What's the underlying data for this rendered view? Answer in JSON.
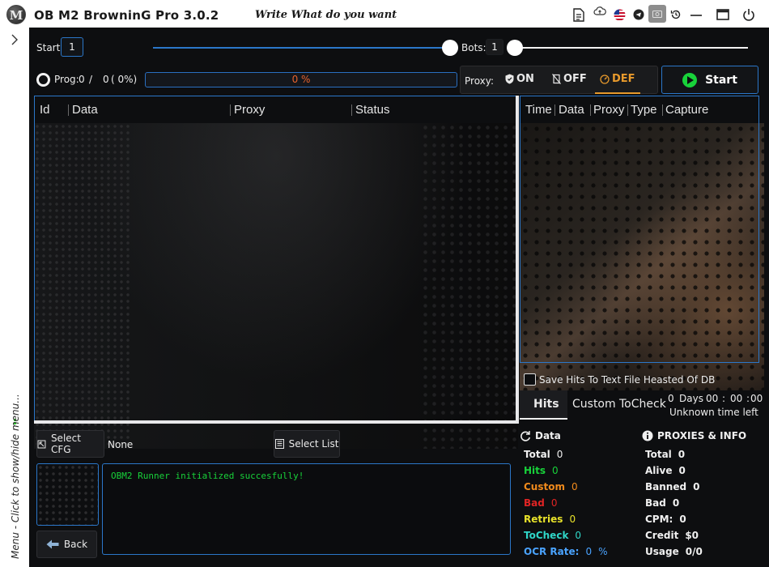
{
  "app": {
    "title": "OB M2 BrowninG Pro  3.0.2",
    "logo_letter": "M",
    "slogan": "Write What do you want"
  },
  "titlebar_icons": [
    "document-icon",
    "cloud-icon",
    "us-flag-icon",
    "telegram-icon",
    "screenshot-icon",
    "history-icon",
    "minimize-icon",
    "maximize-icon",
    "power-icon"
  ],
  "menu": {
    "toggle_label": "Menu - Click to show/hide menu..."
  },
  "controls": {
    "start_label": "Start",
    "start_value": "1",
    "bots_label": "Bots:",
    "bots_value": "1"
  },
  "progress": {
    "prog_label": "Prog:",
    "done": "0",
    "sep": "/",
    "total": "0",
    "percent_text": "( 0%)",
    "bar_text": "0 %",
    "bar_fraction": 0.0
  },
  "proxy": {
    "label": "Proxy:",
    "on": "ON",
    "off": "OFF",
    "def": "DEF",
    "selected": "DEF"
  },
  "start_button": "Start",
  "data_table": {
    "headers": [
      "Id",
      "Data",
      "Proxy",
      "Status"
    ]
  },
  "hits_table": {
    "headers": [
      "Time",
      "Data",
      "Proxy",
      "Type",
      "Capture"
    ]
  },
  "save_hits_label": "Save Hits To Text File Heasted Of DB",
  "tabs": [
    "Hits",
    "Custom",
    "ToCheck"
  ],
  "timer": {
    "days": "0",
    "days_label": "Days",
    "hours": "00",
    "minutes": "00",
    "seconds": "00",
    "colon": ":",
    "eta": "Unknown time left"
  },
  "config": {
    "select_cfg": "Select CFG",
    "cfg_value": "None",
    "select_list": "Select List",
    "back": "Back"
  },
  "log": {
    "line": "OBM2 Runner initialized succesfully!"
  },
  "data_stats": {
    "title": "Data",
    "items": [
      {
        "label": "Total",
        "value": "0",
        "color": "#f0f0f0"
      },
      {
        "label": "Hits",
        "value": "0",
        "color": "#18d23a"
      },
      {
        "label": "Custom",
        "value": "0",
        "color": "#f08a1c"
      },
      {
        "label": "Bad",
        "value": "0",
        "color": "#e02424"
      },
      {
        "label": "Retries",
        "value": "0",
        "color": "#e8e22a"
      },
      {
        "label": "ToCheck",
        "value": "0",
        "color": "#2fd6c8"
      },
      {
        "label": "OCR Rate:",
        "value": "0",
        "suffix": "%",
        "color": "#4aa3ff"
      }
    ]
  },
  "proxy_stats": {
    "title": "PROXIES & INFO",
    "items": [
      {
        "label": "Total",
        "value": "0"
      },
      {
        "label": "Alive",
        "value": "0"
      },
      {
        "label": "Banned",
        "value": "0"
      },
      {
        "label": "Bad",
        "value": "0"
      },
      {
        "label": "CPM:",
        "value": "0"
      },
      {
        "label": "Credit",
        "value": "$0"
      },
      {
        "label": "Usage",
        "value": "0/0"
      }
    ]
  },
  "colors": {
    "accent": "#2b77c9",
    "success": "#18d23a",
    "proxy_def": "#e89a2c",
    "progress_text": "#e8622c"
  }
}
